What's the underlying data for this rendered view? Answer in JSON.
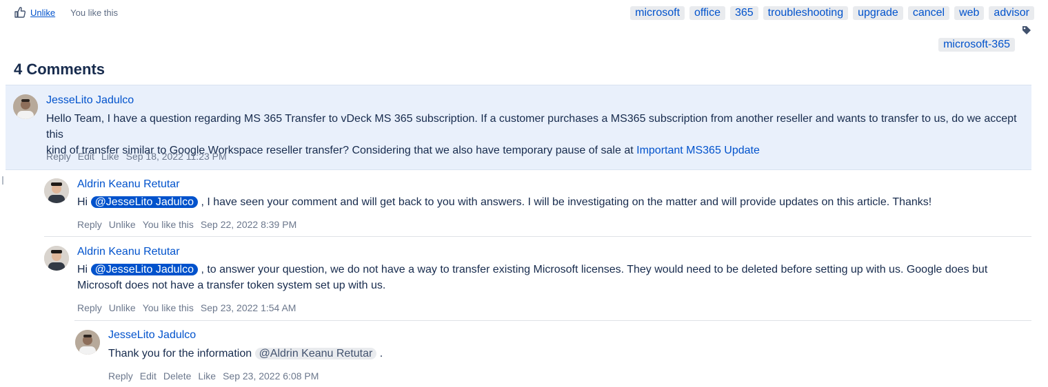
{
  "like_bar": {
    "unlike_label": "Unlike",
    "status": "You like this"
  },
  "labels": [
    "microsoft",
    "office",
    "365",
    "troubleshooting",
    "upgrade",
    "cancel",
    "web",
    "advisor",
    "microsoft-365"
  ],
  "comments_title": "4 Comments",
  "comments": [
    {
      "author": "JesseLito Jadulco",
      "line1": "Hello Team, I have a question regarding MS 365 Transfer to vDeck MS 365 subscription. If a customer purchases a MS365 subscription from another reseller and wants to transfer to us, do we accept this",
      "line2": "kind of transfer similar to Google Workspace reseller transfer? Considering that we also have temporary pause of sale at ",
      "link": "Important MS365 Update",
      "actions": {
        "reply": "Reply",
        "edit": "Edit",
        "like": "Like"
      },
      "timestamp": "Sep 18, 2022 11:23 PM"
    },
    {
      "author": "Aldrin Keanu Retutar",
      "prefix": "Hi ",
      "mention": "@JesseLito Jadulco",
      "text": " , I have seen your comment and will get back to you with answers. I will be investigating on the matter and will provide updates on this article. Thanks!",
      "actions": {
        "reply": "Reply",
        "unlike": "Unlike",
        "liked": "You like this"
      },
      "timestamp": "Sep 22, 2022 8:39 PM"
    },
    {
      "author": "Aldrin Keanu Retutar",
      "prefix": "Hi ",
      "mention": "@JesseLito Jadulco",
      "text": " , to answer your question, we do not have a way to transfer existing Microsoft licenses. They would need to be deleted before setting up with us. Google does but",
      "line2": "Microsoft does not have a transfer token system set up with us.",
      "actions": {
        "reply": "Reply",
        "unlike": "Unlike",
        "liked": "You like this"
      },
      "timestamp": "Sep 23, 2022 1:54 AM"
    },
    {
      "author": "JesseLito Jadulco",
      "prefix": "Thank you for the information ",
      "mention": "@Aldrin Keanu Retutar",
      "text": " .",
      "actions": {
        "reply": "Reply",
        "edit": "Edit",
        "delete": "Delete",
        "like": "Like"
      },
      "timestamp": "Sep 23, 2022 6:08 PM"
    }
  ],
  "icons": {
    "like": "thumbs-up-icon",
    "tag": "tag-icon"
  },
  "colors": {
    "link": "#0052cc",
    "highlight": "#e9f0fb",
    "label_bg": "#e9ebee",
    "mention_bg": "#0052cc"
  }
}
